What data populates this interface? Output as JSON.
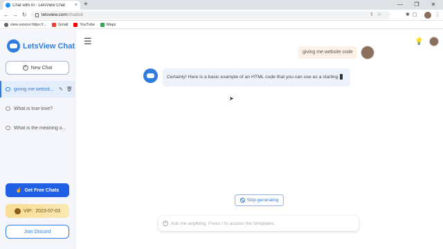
{
  "browser": {
    "tab_title": "Chat with AI - LetsView Chat",
    "tab_close": "×",
    "new_tab": "+",
    "win_minimize": "—",
    "win_restore": "❐",
    "win_close": "✕",
    "back": "←",
    "forward": "→",
    "reload": "↻",
    "url_host": "letsview.com",
    "url_path": "/chatbot",
    "bookmarks": [
      {
        "label": "view-source:https://...",
        "color": "#5f6368"
      },
      {
        "label": "Gmail",
        "color": "#ea4335"
      },
      {
        "label": "YouTube",
        "color": "#ff0000"
      },
      {
        "label": "Maps",
        "color": "#34a853"
      }
    ]
  },
  "sidebar": {
    "logo_text": "LetsView Chat",
    "new_chat_label": "New Chat",
    "history": [
      {
        "label": "giving me websit..."
      },
      {
        "label": "What is true love?"
      },
      {
        "label": "What is the meaning o..."
      }
    ],
    "get_free_label": "Get Free Chats",
    "vip_label": "VIP:",
    "vip_date": "2023-07-03",
    "discord_label": "Join Discord"
  },
  "chat": {
    "user_message": "giving me website code",
    "bot_message": "Certainly! Here is a basic example of an HTML code that you can use as a starting",
    "stop_label": "Stop generating",
    "input_placeholder": "Ask me anything. Press / to access the templates.",
    "input_value": ""
  },
  "colors": {
    "accent": "#2f7de1",
    "primary_button": "#1e5fe6",
    "vip_gold": "#f9dd93",
    "user_bubble": "#fdf0e6",
    "bot_bubble": "#eef2fb"
  }
}
